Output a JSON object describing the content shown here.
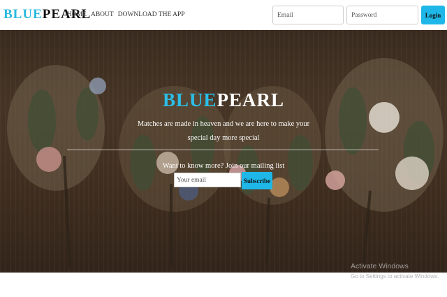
{
  "brand": {
    "part1": "BLUE",
    "part2": "PEARL"
  },
  "nav": {
    "links": [
      "HOME",
      "ABOUT",
      "DOWNLOAD THE APP"
    ],
    "email_placeholder": "Email",
    "password_placeholder": "Password",
    "login_label": "Login"
  },
  "hero": {
    "title_part1": "BLUE",
    "title_part2": "PEARL",
    "tagline": "Matches are made in heaven and we are here to make your special day more special",
    "mailing_label": "Want to know more? Join our mailing list",
    "email_placeholder": "Your email",
    "subscribe_label": "Subscribe"
  },
  "watermark": {
    "title": "Activate Windows",
    "subtitle": "Go to Settings to activate Windows."
  },
  "colors": {
    "accent": "#1eb7e8",
    "brand_blue": "#29b8df",
    "hero_overlay": "#3a2b20"
  }
}
